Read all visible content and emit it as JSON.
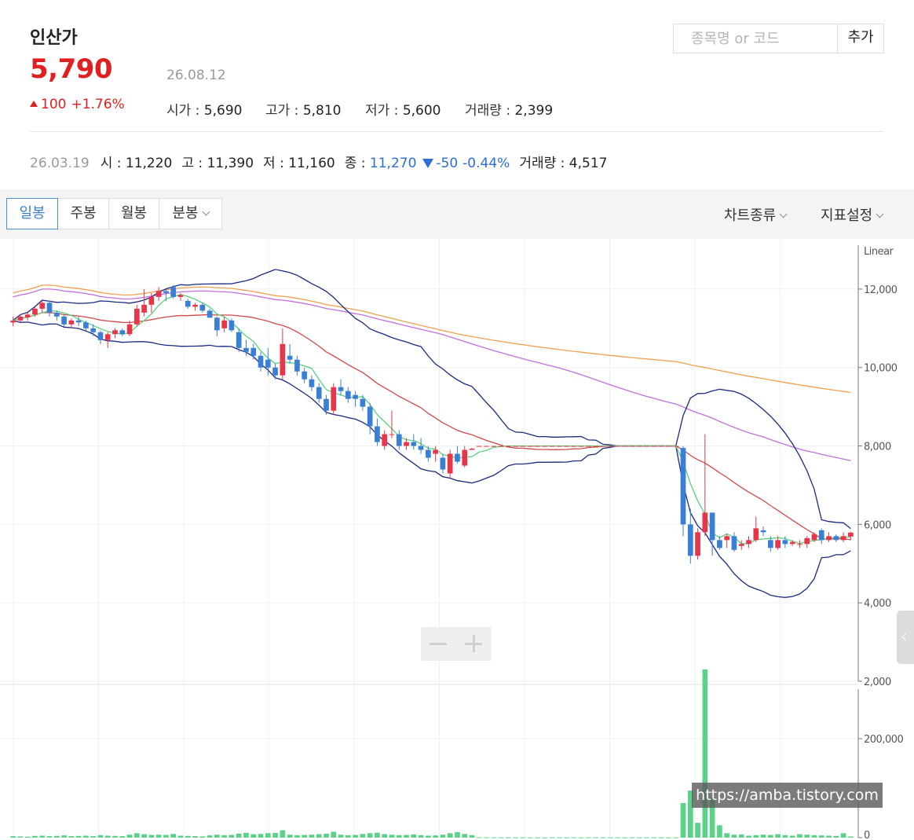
{
  "header": {
    "stock_name": "인산가",
    "current_price": "5,790",
    "date": "26.08.12",
    "change": "100",
    "change_pct": "+1.76%",
    "stats": [
      {
        "label": "시가 : ",
        "value": "5,690"
      },
      {
        "label": "고가 : ",
        "value": "5,810"
      },
      {
        "label": "저가 : ",
        "value": "5,600"
      },
      {
        "label": "거래량 : ",
        "value": "2,399"
      }
    ]
  },
  "search": {
    "placeholder": "종목명 or 코드",
    "add_label": "추가"
  },
  "hover_info": {
    "date": "26.03.19",
    "open_label": "시 : ",
    "open": "11,220",
    "high_label": "고 : ",
    "high": "11,390",
    "low_label": "저 : ",
    "low": "11,160",
    "close_label": "종 : ",
    "close": "11,270",
    "change": "-50",
    "change_pct": "-0.44%",
    "volume_label": "거래량 : ",
    "volume": "4,517"
  },
  "toolbar": {
    "periods": [
      "일봉",
      "주봉",
      "월봉",
      "분봉"
    ],
    "chart_type_label": "차트종류",
    "indicator_label": "지표설정"
  },
  "watermark": "https://amba.tistory.com",
  "colors": {
    "up": "#e8354a",
    "down": "#3a7fd6",
    "ma5": "#5bd17d",
    "ma20": "#d04a4a",
    "ma60": "#c070e0",
    "ma120": "#f0a050",
    "bollinger": "#1a2a80",
    "volume": "#5cd18a"
  },
  "chart_data": {
    "type": "candlestick",
    "price_scale_label": "Linear",
    "ylim": [
      2000,
      13000
    ],
    "y_ticks": [
      2000,
      4000,
      6000,
      8000,
      10000,
      12000
    ],
    "y_tick_labels": [
      "2,000",
      "4,000",
      "6,000",
      "8,000",
      "10,000",
      "12,000"
    ],
    "volume_ylim": [
      0,
      300000
    ],
    "volume_ticks": [
      0,
      200000
    ],
    "volume_tick_labels": [
      "0",
      "200,000"
    ],
    "candles": [
      [
        11150,
        11300,
        11050,
        11200,
        3000
      ],
      [
        11200,
        11350,
        11150,
        11300,
        2500
      ],
      [
        11280,
        11400,
        11200,
        11350,
        2000
      ],
      [
        11350,
        11550,
        11300,
        11500,
        3500
      ],
      [
        11500,
        11700,
        11400,
        11650,
        4000
      ],
      [
        11650,
        11700,
        11300,
        11400,
        3000
      ],
      [
        11400,
        11450,
        11200,
        11300,
        3500
      ],
      [
        11300,
        11350,
        11050,
        11100,
        4500
      ],
      [
        11100,
        11250,
        11000,
        11200,
        3000
      ],
      [
        11200,
        11300,
        11050,
        11150,
        3500
      ],
      [
        11150,
        11200,
        10950,
        11000,
        4000
      ],
      [
        11000,
        11100,
        10800,
        10900,
        3000
      ],
      [
        10900,
        10950,
        10600,
        10700,
        5000
      ],
      [
        10700,
        10900,
        10500,
        10850,
        4000
      ],
      [
        10850,
        11000,
        10750,
        10950,
        3500
      ],
      [
        10950,
        11000,
        10800,
        10850,
        3000
      ],
      [
        10850,
        11200,
        10800,
        11100,
        6000
      ],
      [
        11100,
        11600,
        11050,
        11500,
        9000
      ],
      [
        11400,
        12000,
        11300,
        11600,
        7000
      ],
      [
        11600,
        11900,
        11400,
        11800,
        5500
      ],
      [
        11800,
        12050,
        11700,
        11950,
        6000
      ],
      [
        11950,
        12000,
        11700,
        11900,
        5500
      ],
      [
        12050,
        12100,
        11750,
        11800,
        7500
      ],
      [
        11800,
        11900,
        11700,
        11850,
        4000
      ],
      [
        11700,
        11750,
        11500,
        11550,
        3500
      ],
      [
        11550,
        11650,
        11450,
        11600,
        3000
      ],
      [
        11600,
        11650,
        11400,
        11450,
        2500
      ],
      [
        11450,
        11500,
        11270,
        11270,
        4517
      ],
      [
        11270,
        11300,
        10800,
        10950,
        6000
      ],
      [
        11000,
        11300,
        10900,
        11200,
        5000
      ],
      [
        11200,
        11250,
        10900,
        10950,
        5500
      ],
      [
        10900,
        11000,
        10400,
        10500,
        8000
      ],
      [
        10500,
        10700,
        10300,
        10400,
        9500
      ],
      [
        10500,
        10600,
        10200,
        10300,
        7000
      ],
      [
        10300,
        10400,
        9900,
        10000,
        7500
      ],
      [
        10200,
        10500,
        9800,
        10000,
        9000
      ],
      [
        10000,
        10100,
        9700,
        9800,
        9500
      ],
      [
        9800,
        11000,
        9700,
        10600,
        15000
      ],
      [
        10300,
        10600,
        10100,
        10200,
        6000
      ],
      [
        10200,
        10300,
        9800,
        9900,
        5000
      ],
      [
        9900,
        10000,
        9600,
        9700,
        5500
      ],
      [
        9700,
        9800,
        9400,
        9500,
        6000
      ],
      [
        9500,
        9600,
        9100,
        9200,
        7000
      ],
      [
        9200,
        9300,
        8800,
        8900,
        8000
      ],
      [
        8900,
        9600,
        8800,
        9500,
        12000
      ],
      [
        9500,
        9700,
        9300,
        9400,
        6000
      ],
      [
        9400,
        9500,
        9100,
        9200,
        5000
      ],
      [
        9300,
        9400,
        9000,
        9200,
        5500
      ],
      [
        9200,
        9300,
        8900,
        9000,
        7500
      ],
      [
        9000,
        9100,
        8300,
        8500,
        9000
      ],
      [
        8500,
        8700,
        8000,
        8100,
        10000
      ],
      [
        8000,
        8400,
        7900,
        8300,
        7000
      ],
      [
        8300,
        8900,
        8200,
        8300,
        6000
      ],
      [
        8300,
        8400,
        7900,
        8000,
        5000
      ],
      [
        8000,
        8200,
        7900,
        8100,
        5500
      ],
      [
        8100,
        8300,
        7900,
        8000,
        6500
      ],
      [
        8000,
        8200,
        7800,
        7900,
        5000
      ],
      [
        7900,
        8000,
        7600,
        7700,
        4000
      ],
      [
        7800,
        8000,
        7600,
        7900,
        4500
      ],
      [
        7700,
        7800,
        7300,
        7400,
        6000
      ],
      [
        7300,
        7900,
        7200,
        7800,
        9000
      ],
      [
        7800,
        8000,
        7550,
        7600,
        11000
      ],
      [
        7500,
        8000,
        7450,
        7900,
        7500
      ],
      [
        7900,
        7950,
        7900,
        7930,
        5000
      ],
      [
        8000,
        8000,
        8000,
        8000,
        800
      ],
      [
        8000,
        8000,
        8000,
        8000,
        700
      ],
      [
        8000,
        8000,
        8000,
        8000,
        600
      ],
      [
        8000,
        8000,
        8000,
        8000,
        600
      ],
      [
        8000,
        8000,
        8000,
        8000,
        500
      ],
      [
        8000,
        8000,
        8000,
        8000,
        500
      ],
      [
        8000,
        8000,
        8000,
        8000,
        500
      ],
      [
        8000,
        8000,
        8000,
        8000,
        500
      ],
      [
        8000,
        8000,
        8000,
        8000,
        500
      ],
      [
        8000,
        8000,
        8000,
        8000,
        500
      ],
      [
        8000,
        8000,
        8000,
        8000,
        500
      ],
      [
        8000,
        8000,
        8000,
        8000,
        500
      ],
      [
        8000,
        8000,
        8000,
        8000,
        500
      ],
      [
        8000,
        8000,
        8000,
        8000,
        500
      ],
      [
        8000,
        8000,
        8000,
        8000,
        500
      ],
      [
        8000,
        8000,
        8000,
        8000,
        500
      ],
      [
        8000,
        8000,
        8000,
        8000,
        500
      ],
      [
        8000,
        8000,
        8000,
        8000,
        500
      ],
      [
        8000,
        8000,
        8000,
        8000,
        500
      ],
      [
        8000,
        8000,
        8000,
        8000,
        500
      ],
      [
        8000,
        8000,
        8000,
        8000,
        500
      ],
      [
        8000,
        8000,
        8000,
        8000,
        500
      ],
      [
        8000,
        8000,
        8000,
        8000,
        500
      ],
      [
        8000,
        8000,
        8000,
        8000,
        500
      ],
      [
        8000,
        8000,
        8000,
        8000,
        500
      ],
      [
        8000,
        8000,
        8000,
        8000,
        500
      ],
      [
        8000,
        8000,
        8000,
        8000,
        500
      ],
      [
        8000,
        8000,
        8000,
        8000,
        500
      ],
      [
        7950,
        8000,
        5700,
        6000,
        70000
      ],
      [
        6000,
        6400,
        5000,
        5200,
        95000
      ],
      [
        5200,
        5900,
        5100,
        5800,
        30000
      ],
      [
        5800,
        8300,
        5700,
        6300,
        340000
      ],
      [
        6300,
        6300,
        5200,
        5600,
        80000
      ],
      [
        5600,
        5700,
        5350,
        5400,
        25000
      ],
      [
        5600,
        5750,
        5400,
        5700,
        9000
      ],
      [
        5700,
        5800,
        5300,
        5350,
        6000
      ],
      [
        5450,
        5600,
        5350,
        5500,
        6500
      ],
      [
        5500,
        5700,
        5400,
        5600,
        4000
      ],
      [
        5600,
        6200,
        5550,
        5900,
        5000
      ],
      [
        5850,
        5950,
        5700,
        5800,
        6000
      ],
      [
        5600,
        5700,
        5300,
        5400,
        5500
      ],
      [
        5400,
        5700,
        5350,
        5600,
        7000
      ],
      [
        5600,
        5700,
        5400,
        5500,
        5000
      ],
      [
        5500,
        5600,
        5450,
        5550,
        4000
      ],
      [
        5500,
        5600,
        5400,
        5500,
        7000
      ],
      [
        5500,
        5700,
        5400,
        5650,
        6000
      ],
      [
        5600,
        5800,
        5550,
        5750,
        5000
      ],
      [
        5850,
        5900,
        5500,
        5600,
        4500
      ],
      [
        5600,
        5800,
        5550,
        5700,
        4000
      ],
      [
        5700,
        5750,
        5550,
        5600,
        3500
      ],
      [
        5600,
        5800,
        5550,
        5700,
        9000
      ],
      [
        5690,
        5810,
        5600,
        5790,
        2399
      ]
    ]
  }
}
